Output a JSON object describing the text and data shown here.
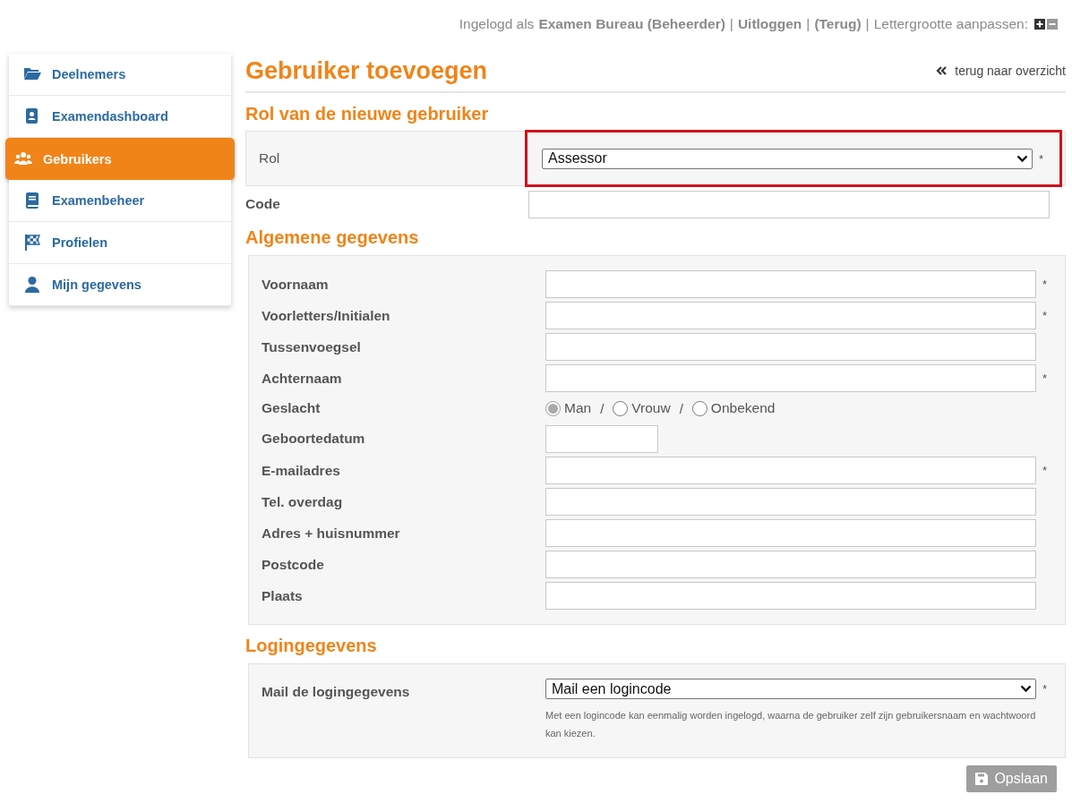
{
  "header": {
    "items": [
      {
        "kind": "text",
        "text": "Ingelogd als"
      },
      {
        "kind": "bold",
        "text": "Examen Bureau (Beheerder)"
      },
      {
        "kind": "sep",
        "text": "|"
      },
      {
        "kind": "link",
        "text": "Uitloggen"
      },
      {
        "kind": "sep",
        "text": "|"
      },
      {
        "kind": "link",
        "text": "(Terug)"
      },
      {
        "kind": "sep",
        "text": "|"
      },
      {
        "kind": "text",
        "text": "Lettergrootte aanpassen:"
      }
    ]
  },
  "sidebar": {
    "items": [
      {
        "label": "Deelnemers",
        "selected": false
      },
      {
        "label": "Examendashboard",
        "selected": false
      },
      {
        "label": "Gebruikers",
        "selected": true
      },
      {
        "label": "Examenbeheer",
        "selected": false
      },
      {
        "label": "Profielen",
        "selected": false
      },
      {
        "label": "Mijn gegevens",
        "selected": false
      }
    ]
  },
  "page": {
    "title": "Gebruiker toevoegen",
    "back_link": "terug naar overzicht"
  },
  "role_section": {
    "title": "Rol van de nieuwe gebruiker",
    "role": {
      "label": "Rol",
      "value": "Assessor",
      "required": "*",
      "highlighted": true
    },
    "code": {
      "label": "Code"
    }
  },
  "general_section": {
    "title": "Algemene gegevens",
    "fields": [
      {
        "kind": "text",
        "label": "Voornaam",
        "required": "*"
      },
      {
        "kind": "text",
        "label": "Voorletters/Initialen",
        "required": "*"
      },
      {
        "kind": "text",
        "label": "Tussenvoegsel"
      },
      {
        "kind": "text",
        "label": "Achternaam",
        "required": "*"
      },
      {
        "kind": "radio",
        "label": "Geslacht",
        "options": [
          {
            "label": "Man",
            "selected": true
          },
          {
            "label": "Vrouw",
            "selected": false
          },
          {
            "label": "Onbekend",
            "selected": false
          }
        ],
        "separators": [
          "/",
          "/"
        ]
      },
      {
        "kind": "short",
        "label": "Geboortedatum"
      },
      {
        "kind": "text",
        "label": "E-mailadres",
        "required": "*"
      },
      {
        "kind": "text",
        "label": "Tel. overdag"
      },
      {
        "kind": "text",
        "label": "Adres + huisnummer"
      },
      {
        "kind": "text",
        "label": "Postcode"
      },
      {
        "kind": "text",
        "label": "Plaats"
      }
    ]
  },
  "login_section": {
    "title": "Logingegevens",
    "field": {
      "label": "Mail de logingegevens",
      "value": "Mail een logincode",
      "required": "*",
      "help": "Met een logincode kan eenmalig worden ingelogd, waarna de gebruiker zelf zijn gebruikersnaam en wachtwoord kan kiezen."
    }
  },
  "save_button": {
    "label": "Opslaan",
    "disabled": true
  }
}
